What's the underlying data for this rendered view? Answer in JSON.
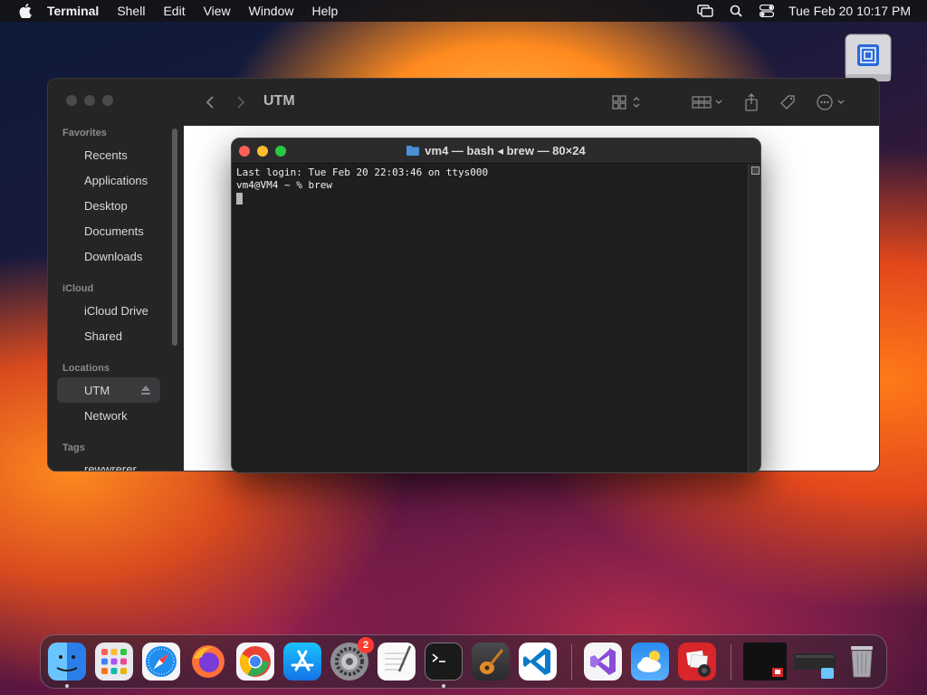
{
  "menubar": {
    "app_name": "Terminal",
    "menus": [
      "Shell",
      "Edit",
      "View",
      "Window",
      "Help"
    ],
    "clock": "Tue Feb 20  10:17 PM"
  },
  "finder": {
    "title": "UTM",
    "sections": {
      "favorites": "Favorites",
      "icloud": "iCloud",
      "locations": "Locations",
      "tags": "Tags"
    },
    "favorites": [
      "Recents",
      "Applications",
      "Desktop",
      "Documents",
      "Downloads"
    ],
    "icloud": [
      "iCloud Drive",
      "Shared"
    ],
    "locations": [
      "UTM",
      "Network"
    ],
    "tags": [
      "rewwrerer"
    ]
  },
  "terminal": {
    "title": "vm4 — bash ◂ brew — 80×24",
    "lines": [
      "Last login: Tue Feb 20 22:03:46 on ttys000",
      "vm4@VM4 ~ % brew"
    ]
  },
  "dock": {
    "settings_badge": "2",
    "apps": [
      "finder-icon",
      "launchpad-icon",
      "safari-icon",
      "firefox-icon",
      "chrome-icon",
      "app-store-icon",
      "system-settings-icon",
      "textedit-icon",
      "terminal-icon",
      "garageband-icon",
      "vscode-icon",
      "visual-studio-icon",
      "weather-icon",
      "photo-booth-icon",
      "trash-icon"
    ]
  }
}
